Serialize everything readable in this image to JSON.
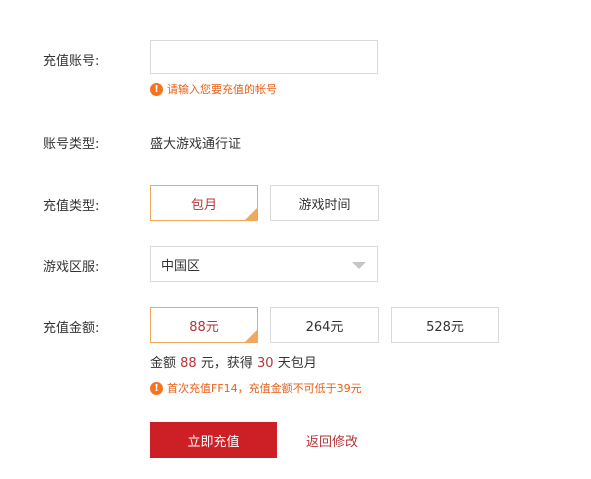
{
  "form": {
    "account": {
      "label": "充值账号:",
      "value": "",
      "placeholder": "",
      "hint": "请输入您要充值的帐号"
    },
    "account_type": {
      "label": "账号类型:",
      "value": "盛大游戏通行证"
    },
    "recharge_type": {
      "label": "充值类型:",
      "options": [
        "包月",
        "游戏时间"
      ],
      "selected": "包月"
    },
    "server": {
      "label": "游戏区服:",
      "selected": "中国区"
    },
    "amount": {
      "label": "充值金额:",
      "options": [
        "88元",
        "264元",
        "528元"
      ],
      "selected": "88元"
    },
    "summary": {
      "prefix": "金额",
      "amount": "88",
      "middle": "元，获得",
      "days": "30",
      "suffix": "天包月"
    },
    "amount_hint": "首次充值FF14，充值金额不可低于39元"
  },
  "actions": {
    "submit_label": "立即充值",
    "back_label": "返回修改"
  },
  "icons": {
    "warning": "warning-circle-icon",
    "dropdown": "triangle-down-icon",
    "selected_corner": "selected-corner-mark"
  },
  "colors": {
    "primary": "#cc2026",
    "accent_text": "#b5353a",
    "selected_border": "#f0a75e",
    "hint_text": "#e8601a"
  }
}
